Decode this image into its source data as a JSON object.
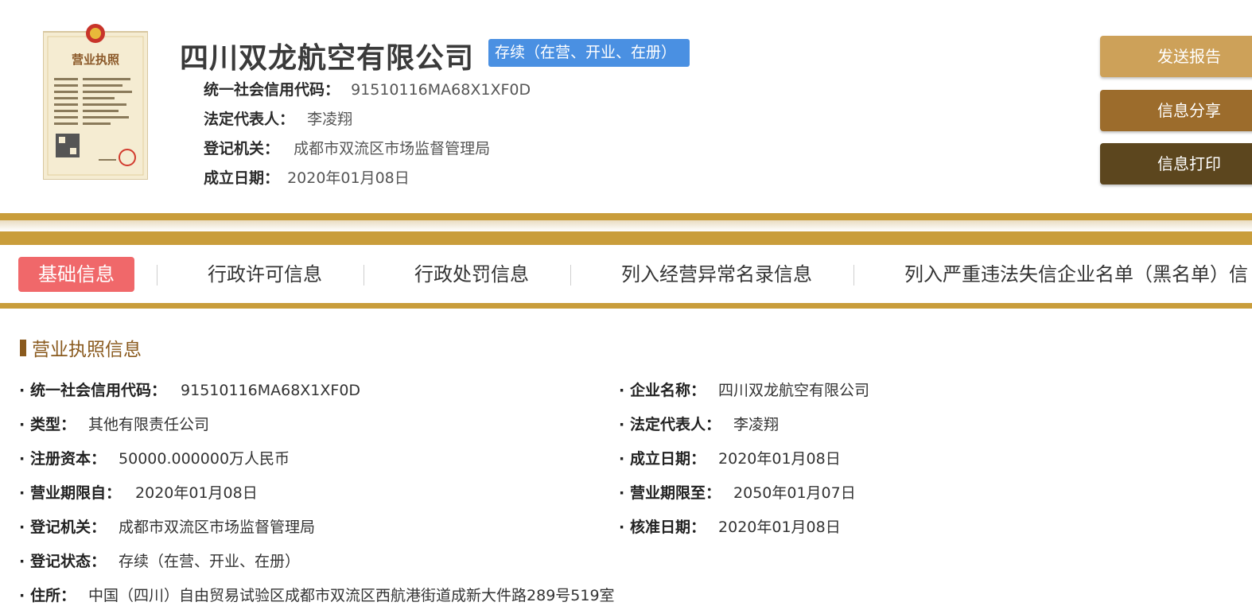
{
  "header": {
    "license_image": {
      "title": "营业执照",
      "icon": "national-emblem-icon"
    },
    "company_name": "四川双龙航空有限公司",
    "status": "存续（在营、开业、在册）",
    "rows": [
      {
        "label": "统一社会信用代码：",
        "value": "91510116MA68X1XF0D"
      },
      {
        "label": "法定代表人：",
        "value": "李凌翔"
      },
      {
        "label": "登记机关：",
        "value": "成都市双流区市场监督管理局"
      },
      {
        "label": "成立日期：",
        "value": "2020年01月08日"
      }
    ]
  },
  "actions": {
    "send": "发送报告",
    "share": "信息分享",
    "print": "信息打印"
  },
  "tabs": [
    "基础信息",
    "行政许可信息",
    "行政处罚信息",
    "列入经营异常名录信息",
    "列入严重违法失信企业名单（黑名单）信"
  ],
  "section": {
    "title": "营业执照信息",
    "left": [
      {
        "label": "统一社会信用代码：",
        "value": "91510116MA68X1XF0D"
      },
      {
        "label": "类型：",
        "value": "其他有限责任公司"
      },
      {
        "label": "注册资本：",
        "value": "50000.000000万人民币"
      },
      {
        "label": "营业期限自：",
        "value": "2020年01月08日"
      },
      {
        "label": "登记机关：",
        "value": "成都市双流区市场监督管理局"
      },
      {
        "label": "登记状态：",
        "value": "存续（在营、开业、在册）"
      },
      {
        "label": "住所：",
        "value": "中国（四川）自由贸易试验区成都市双流区西航港街道成新大件路289号519室"
      }
    ],
    "right": [
      {
        "label": "企业名称：",
        "value": "四川双龙航空有限公司"
      },
      {
        "label": "法定代表人：",
        "value": "李凌翔"
      },
      {
        "label": "成立日期：",
        "value": "2020年01月08日"
      },
      {
        "label": "营业期限至：",
        "value": "2050年01月07日"
      },
      {
        "label": "核准日期：",
        "value": "2020年01月08日"
      }
    ]
  },
  "colors": {
    "gold": "#c99d3b",
    "active_tab": "#f0686a",
    "status_badge": "#4a90e2",
    "section_title": "#8a5a1e"
  }
}
